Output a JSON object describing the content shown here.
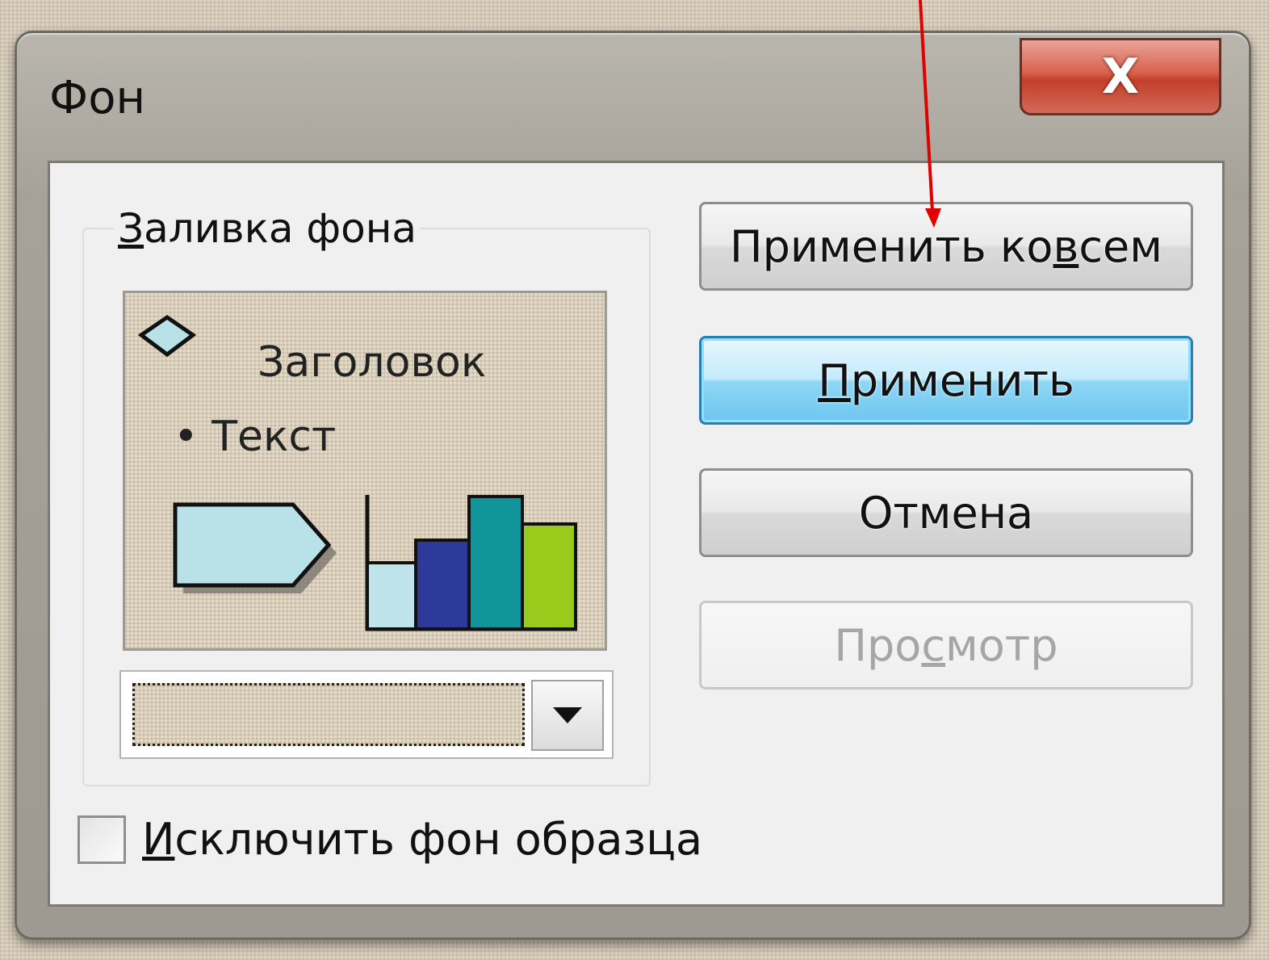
{
  "window": {
    "title": "Фон",
    "close_label": "X"
  },
  "fill_group": {
    "label": "Заливка фона",
    "preview": {
      "title_text": "Заголовок",
      "bullet_text": "• Текст"
    },
    "combo": {
      "selected": ""
    }
  },
  "buttons": {
    "apply_all": "Применить ко всем",
    "apply": "Применить",
    "cancel": "Отмена",
    "preview": "Просмотр"
  },
  "checkbox": {
    "label": "Исключить фон образца",
    "checked": false
  },
  "preview_chart": {
    "bar_colors": [
      "#bfe3ea",
      "#2e3a9a",
      "#12959a",
      "#9acb1c"
    ],
    "shape_color": "#b9e1e8"
  },
  "annotation": {
    "arrow_color": "#e00000"
  }
}
